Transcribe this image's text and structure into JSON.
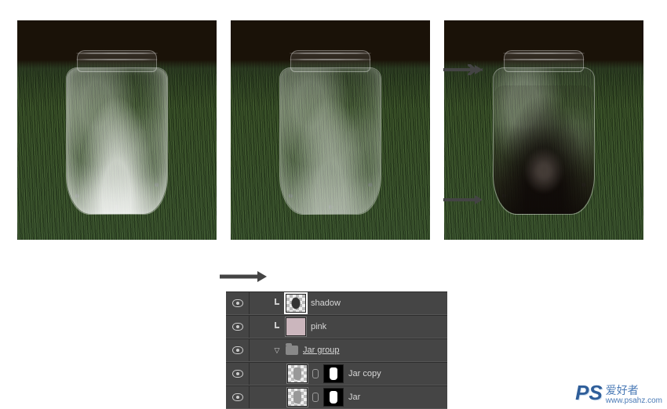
{
  "images": {
    "variants": [
      "white-glow",
      "white-glow-soft",
      "dark-shadow"
    ]
  },
  "layers_panel": {
    "rows": [
      {
        "id": "shadow",
        "name": "shadow",
        "clipped": true,
        "thumb": "shadow",
        "selected": true
      },
      {
        "id": "pink",
        "name": "pink",
        "clipped": true,
        "thumb": "pink"
      },
      {
        "id": "jargroup",
        "name": "Jar group",
        "type": "group",
        "expanded": true
      },
      {
        "id": "jarcopy",
        "name": "Jar copy",
        "thumb": "jar",
        "mask": true,
        "indent": 2
      },
      {
        "id": "jar",
        "name": "Jar",
        "thumb": "jar",
        "mask": true,
        "indent": 2
      }
    ]
  },
  "watermark": {
    "logo": "PS",
    "text": "爱好者",
    "url": "www.psahz.com"
  }
}
